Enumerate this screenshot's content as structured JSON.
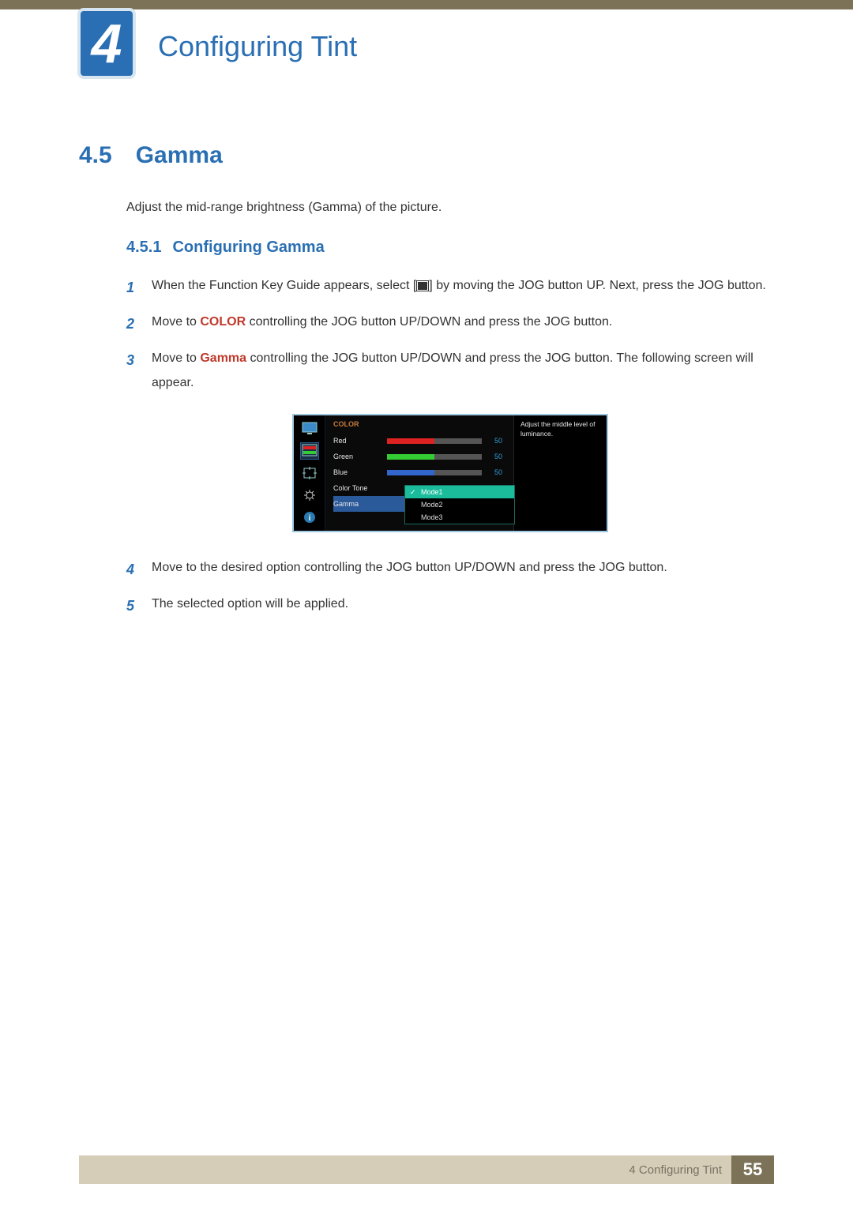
{
  "chapter": {
    "number": "4",
    "title": "Configuring Tint"
  },
  "section": {
    "number": "4.5",
    "title": "Gamma",
    "description": "Adjust the mid-range brightness (Gamma) of the picture."
  },
  "subsection": {
    "number": "4.5.1",
    "title": "Configuring Gamma"
  },
  "steps": {
    "s1a": "When the Function Key Guide appears, select [",
    "s1b": "] by moving the JOG button UP. Next, press the JOG button.",
    "s2a": "Move to ",
    "s2_color": "COLOR",
    "s2b": " controlling the JOG button UP/DOWN and press the JOG button.",
    "s3a": "Move to ",
    "s3_gamma": "Gamma",
    "s3b": " controlling the JOG button UP/DOWN and press the JOG button. The following screen will appear.",
    "s4": "Move to the desired option controlling the JOG button UP/DOWN and press the JOG button.",
    "s5": "The selected option will be applied."
  },
  "step_numbers": {
    "n1": "1",
    "n2": "2",
    "n3": "3",
    "n4": "4",
    "n5": "5"
  },
  "osd": {
    "title": "COLOR",
    "rows": {
      "red": {
        "label": "Red",
        "value": "50",
        "fill_pct": 50,
        "color": "#d22"
      },
      "green": {
        "label": "Green",
        "value": "50",
        "fill_pct": 50,
        "color": "#3c3"
      },
      "blue": {
        "label": "Blue",
        "value": "50",
        "fill_pct": 50,
        "color": "#36c"
      },
      "color_tone": {
        "label": "Color Tone"
      },
      "gamma": {
        "label": "Gamma"
      }
    },
    "dropdown": {
      "opt1": "Mode1",
      "opt2": "Mode2",
      "opt3": "Mode3"
    },
    "help": "Adjust the middle level of luminance."
  },
  "footer": {
    "text": "4 Configuring Tint",
    "page": "55"
  }
}
